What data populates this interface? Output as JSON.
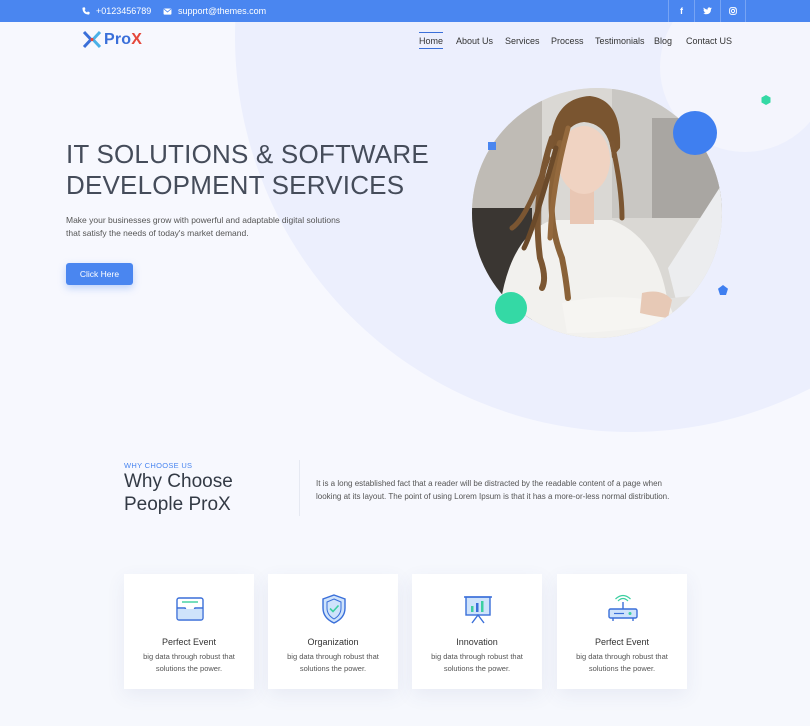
{
  "topbar": {
    "phone": "+0123456789",
    "email": "support@themes.com",
    "social": [
      {
        "icon": "facebook-icon",
        "glyph": "f"
      },
      {
        "icon": "twitter-icon",
        "glyph": "t"
      },
      {
        "icon": "instagram-icon",
        "glyph": "◎"
      }
    ]
  },
  "brand": {
    "name_part1": "Pro",
    "name_part2": "X"
  },
  "nav": {
    "items": [
      "Home",
      "About Us",
      "Services",
      "Process",
      "Testimonials",
      "Blog",
      "Contact US"
    ],
    "active": "Home"
  },
  "hero": {
    "title_line1": "IT SOLUTIONS & SOFTWARE",
    "title_line2": "DEVELOPMENT SERVICES",
    "desc_line1": "Make your businesses grow with powerful and adaptable digital solutions",
    "desc_line2": "that satisfy the needs of today's market demand.",
    "button": "Click Here"
  },
  "why": {
    "kicker": "WHY CHOOSE US",
    "title_line1": "Why Choose",
    "title_line2": "People ProX",
    "text_line1": "It is a long established fact that a reader will be distracted by the readable content of a page when",
    "text_line2": "looking at its layout. The point of using Lorem Ipsum is that it has a more-or-less normal distribution."
  },
  "cards": [
    {
      "title": "Perfect Event",
      "line1": "big data through robust that",
      "line2": "solutions the power.",
      "icon": "inbox-tray-icon"
    },
    {
      "title": "Organization",
      "line1": "big data through robust that",
      "line2": "solutions the power.",
      "icon": "shield-check-icon"
    },
    {
      "title": "Innovation",
      "line1": "big data through robust that",
      "line2": "solutions the power.",
      "icon": "presentation-board-icon"
    },
    {
      "title": "Perfect Event",
      "line1": "big data through robust that",
      "line2": "solutions the power.",
      "icon": "router-icon"
    }
  ],
  "colors": {
    "accent": "#4a86f0",
    "accent_dark": "#3a6fd9",
    "logo_x": "#e5483b",
    "green_dot": "#34d9a5"
  }
}
